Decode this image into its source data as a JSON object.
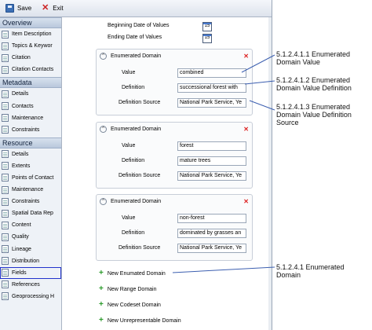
{
  "toolbar": {
    "save_label": "Save",
    "exit_label": "Exit"
  },
  "sidebar": {
    "overview": {
      "title": "Overview",
      "items": [
        "Item Description",
        "Topics & Keywor",
        "Citation",
        "Citation Contacts"
      ]
    },
    "metadata": {
      "title": "Metadata",
      "items": [
        "Details",
        "Contacts",
        "Maintenance",
        "Constraints"
      ]
    },
    "resource": {
      "title": "Resource",
      "items": [
        "Details",
        "Extents",
        "Points of Contact",
        "Maintenance",
        "Constraints",
        "Spatial Data Rep",
        "Content",
        "Quality",
        "Lineage",
        "Distribution",
        "Fields",
        "References",
        "Geoprocessing H"
      ]
    }
  },
  "dates": {
    "begin_label": "Beginning Date of Values",
    "end_label": "Ending Date of Values",
    "calendar_text": "15"
  },
  "domains": [
    {
      "title": "Enumerated Domain",
      "value_label": "Value",
      "value": "combined",
      "definition_label": "Definition",
      "definition": "successional forest with",
      "source_label": "Definition Source",
      "source": "National Park Service, Ye"
    },
    {
      "title": "Enumerated Domain",
      "value_label": "Value",
      "value": "forest",
      "definition_label": "Definition",
      "definition": "mature trees",
      "source_label": "Definition Source",
      "source": "National Park Service, Ye"
    },
    {
      "title": "Enumerated Domain",
      "value_label": "Value",
      "value": "non-forest",
      "definition_label": "Definition",
      "definition": "dominated by grasses an",
      "source_label": "Definition Source",
      "source": "National Park Service, Ye"
    }
  ],
  "new_links": [
    "New Enumated Domain",
    "New Range Domain",
    "New Codeset Domain",
    "New Unrepresentable Domain"
  ],
  "icons": {
    "collapse": "chevron-up-icon",
    "delete": "delete-x-icon",
    "add": "plus-icon",
    "calendar": "calendar-icon",
    "save": "save-icon",
    "exit": "close-icon",
    "document": "document-icon"
  },
  "annotations": [
    {
      "line1": "5.1.2.4.1.1 Enumerated",
      "line2": "Domain Value",
      "line3": ""
    },
    {
      "line1": "5.1.2.4.1.2 Enumerated",
      "line2": "Domain Value Definition",
      "line3": ""
    },
    {
      "line1": "5.1.2.4.1.3 Enumerated",
      "line2": "Domain Value Definition",
      "line3": "Source"
    },
    {
      "line1": "5.1.2.4.1 Enumerated",
      "line2": "Domain",
      "line3": ""
    }
  ],
  "colors": {
    "active_outline": "#2233cc",
    "annotation_line": "#3c5fb0",
    "delete": "#dd2222",
    "add": "#2a9a2a"
  }
}
